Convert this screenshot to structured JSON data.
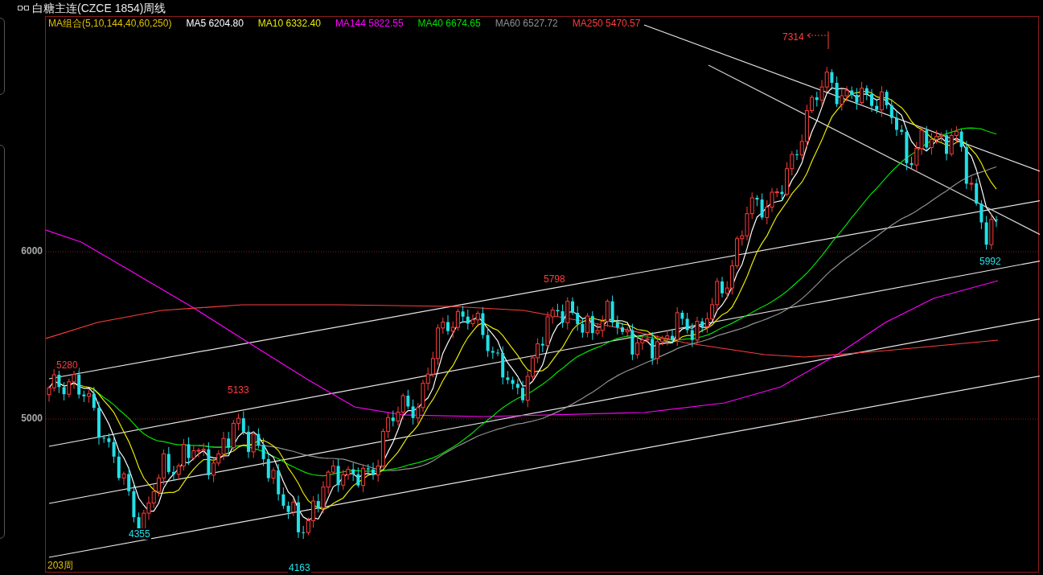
{
  "window": {
    "title": "白糖主连(CZCE 1854)周线"
  },
  "ma_legend": {
    "label": "MA组合(5,10,144,40,60,250)",
    "items": [
      {
        "name": "MA5",
        "value": "6204.80",
        "color": "#ffffff"
      },
      {
        "name": "MA10",
        "value": "6332.40",
        "color": "#e8e800"
      },
      {
        "name": "MA144",
        "value": "5822.55",
        "color": "#ff00ff"
      },
      {
        "name": "MA40",
        "value": "6674.65",
        "color": "#00e000"
      },
      {
        "name": "MA60",
        "value": "6527.72",
        "color": "#909090"
      },
      {
        "name": "MA250",
        "value": "5470.57",
        "color": "#ff3c3c"
      }
    ]
  },
  "price_axis": [
    "6000",
    "5000"
  ],
  "annotations": [
    {
      "text": "7314",
      "kind": "high"
    },
    {
      "text": "5798",
      "kind": "high"
    },
    {
      "text": "5280",
      "kind": "high"
    },
    {
      "text": "5133",
      "kind": "high"
    },
    {
      "text": "4355",
      "kind": "low"
    },
    {
      "text": "4163",
      "kind": "low"
    },
    {
      "text": "5992",
      "kind": "low"
    }
  ],
  "bar_count": "203周"
}
